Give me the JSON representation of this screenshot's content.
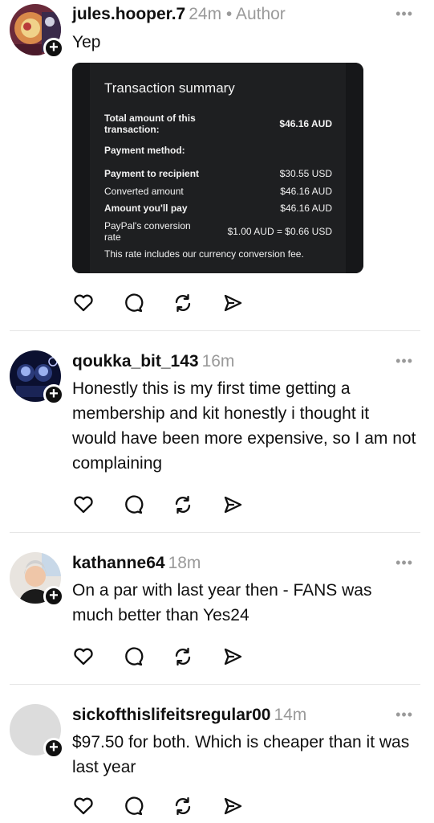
{
  "posts": [
    {
      "username": "jules.hooper.7",
      "meta": "24m • Author",
      "text": "Yep",
      "attachment": {
        "title": "Transaction summary",
        "rows": [
          {
            "label": "Total amount of this transaction:",
            "value": "$46.16 AUD",
            "bold": true
          },
          {
            "label": "Payment method:",
            "value": "",
            "bold": true
          },
          {
            "label": "Payment to recipient",
            "value": "$30.55 USD",
            "bold": true
          },
          {
            "label": "Converted amount",
            "value": "$46.16 AUD",
            "bold": false
          },
          {
            "label": "Amount you'll pay",
            "value": "$46.16 AUD",
            "bold": true
          },
          {
            "label": "PayPal's conversion rate",
            "value": "$1.00 AUD = $0.66 USD",
            "bold": false
          }
        ],
        "note": "This rate includes our currency conversion fee."
      }
    },
    {
      "username": "qoukka_bit_143",
      "meta": "16m",
      "text": "Honestly this is my first time getting a membership and kit honestly i thought it would have been more expensive, so I am not complaining"
    },
    {
      "username": "kathanne64",
      "meta": "18m",
      "text": "On a par with last year then - FANS was much better than Yes24"
    },
    {
      "username": "sickofthislifeitsregular00",
      "meta": "14m",
      "text": "$97.50 for both. Which is cheaper than it was last year"
    }
  ],
  "more_label": "•••",
  "follow_label": "+",
  "icons": [
    "heart-icon",
    "comment-icon",
    "repost-icon",
    "share-icon"
  ],
  "colors": {
    "text": "#101010",
    "muted": "#9a9a9a",
    "card_bg": "#1e1f21",
    "divider": "#e6e6e6"
  }
}
